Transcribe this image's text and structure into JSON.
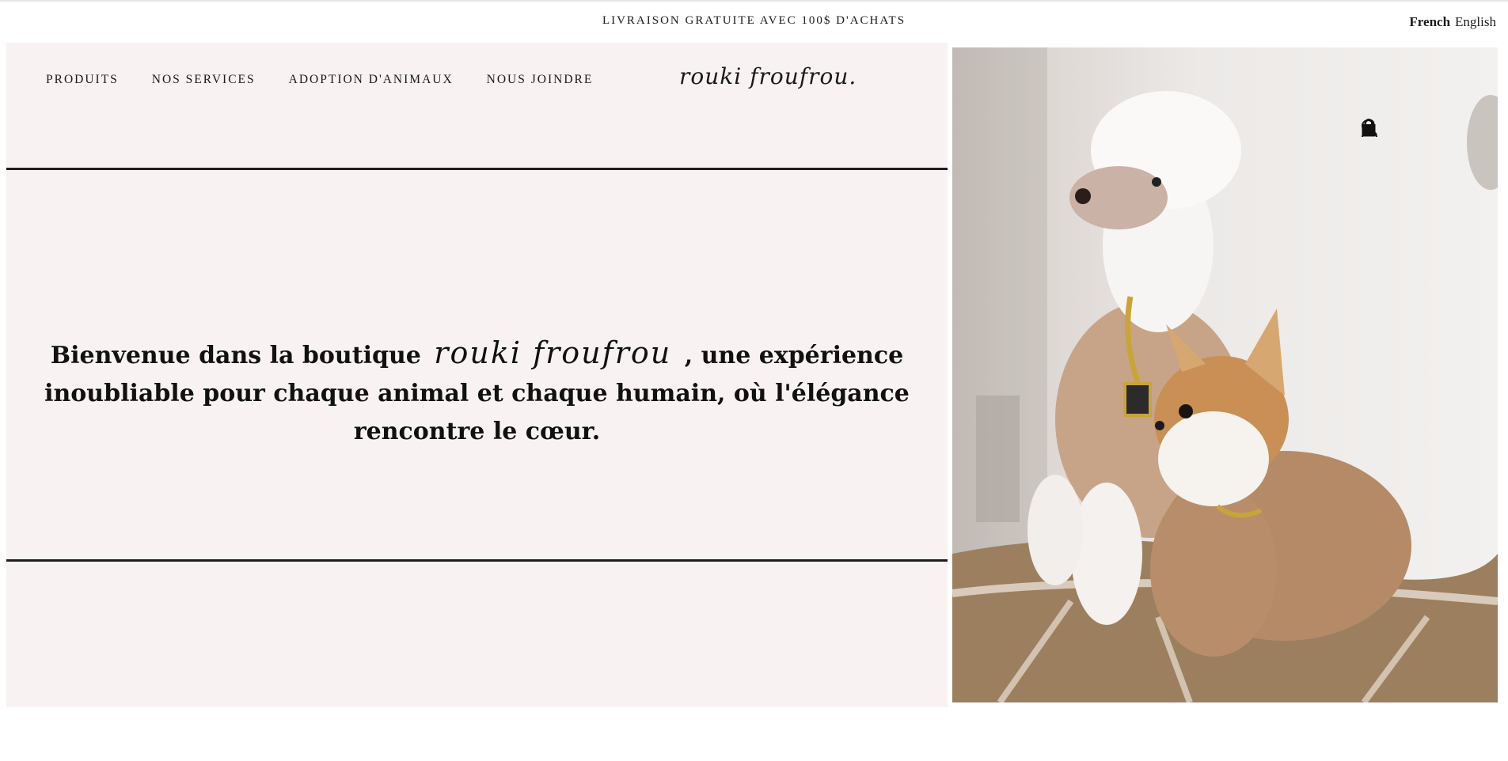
{
  "announcement": "LIVRAISON GRATUITE AVEC 100$ D'ACHATS",
  "language": {
    "active": "French",
    "other": "English"
  },
  "nav": {
    "items": [
      {
        "label": "PRODUITS"
      },
      {
        "label": "NOS SERVICES"
      },
      {
        "label": "ADOPTION D'ANIMAUX"
      },
      {
        "label": "NOUS JOINDRE"
      }
    ],
    "logo": "rouki froufrou."
  },
  "header_icons": [
    "account-icon",
    "search-icon",
    "cart-icon"
  ],
  "hero": {
    "text_before": "Bienvenue dans la boutique",
    "brand": "rouki froufrou",
    "text_after": ", une expérience inoubliable pour chaque animal et chaque humain, où l'élégance rencontre le cœur."
  },
  "colors": {
    "panel_bg": "#f8f3f2",
    "text": "#111111",
    "rule": "#1e1e1e"
  }
}
